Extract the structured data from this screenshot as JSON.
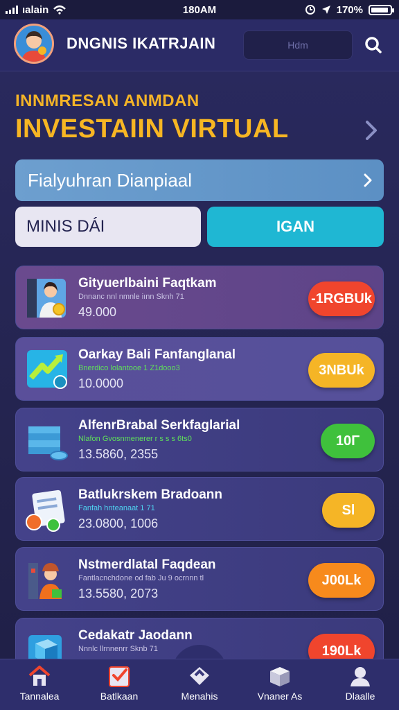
{
  "status_bar": {
    "carrier": "ıalain",
    "time": "180AM",
    "battery_text": "170%",
    "battery_level": 0.8
  },
  "header": {
    "title": "DNGNIS IKATRJAIN",
    "search_placeholder": "Hdm"
  },
  "hero": {
    "subtitle": "INNMRESAN ANMDAN",
    "title": "INVESTAIIN VIRTUAL"
  },
  "banner": {
    "label": "Fialyuhran Dianpiaal"
  },
  "segments": {
    "left": "MINIS DÁI",
    "right": "IGAN"
  },
  "colors": {
    "accent_gold": "#f7b623",
    "accent_cyan": "#1fb7d3",
    "pill_red": "#f0452d",
    "pill_yellow": "#f5b526",
    "pill_green": "#3fc13c",
    "pill_orange": "#f78a1c"
  },
  "items": [
    {
      "name": "Gityuerlbaini Faqtkam",
      "sub": "Dnnanc nnl nmnle iınn Sknh 71",
      "sub_color": "#c9c4e4",
      "value": "49.000",
      "badge": "-1RGBUk",
      "badge_color": "#f0452d",
      "icon": "cash-register-person-icon"
    },
    {
      "name": "Oarkay Bali Fanfanglanal",
      "sub": "Bnerdico lolantooe 1 Z1dooo3",
      "sub_color": "#5fe05a",
      "value": "10.0000",
      "badge": "3NBUk",
      "badge_color": "#f5b526",
      "icon": "trend-chart-icon"
    },
    {
      "name": "AlfenrBrabal Serkfaglarial",
      "sub": "Nlafon Gvosnmenerer r s s s 6ts0",
      "sub_color": "#5fe05a",
      "value": "13.5860, 2355",
      "badge": "10Γ",
      "badge_color": "#3fc13c",
      "icon": "stacked-books-icon"
    },
    {
      "name": "Batlukrskem Bradoann",
      "sub": "Fanfah hnteanaat 1 71",
      "sub_color": "#4fd3f0",
      "value": "23.0800, 1006",
      "badge": "Sl",
      "badge_color": "#f5b526",
      "icon": "document-coins-icon"
    },
    {
      "name": "Nstmerdlatal Faqdean",
      "sub": "Fantlacnchdone od fab Ju 9 ocrnnn tl",
      "sub_color": "#c9c4e4",
      "value": "13.5580, 2073",
      "badge": "J00Lk",
      "badge_color": "#f78a1c",
      "icon": "worker-person-icon"
    },
    {
      "name": "Cedakatr Jaodann",
      "sub": "Nnnlc llrnnenrr Sknb 71",
      "sub_color": "#c9c4e4",
      "value": "",
      "badge": "190Lk",
      "badge_color": "#f0452d",
      "icon": "cube-box-icon"
    }
  ],
  "nav": [
    {
      "label": "Tannalea",
      "icon": "home-icon"
    },
    {
      "label": "Batlkaan",
      "icon": "checklist-icon"
    },
    {
      "label": "Menahis",
      "icon": "tag-icon"
    },
    {
      "label": "Vnaner As",
      "icon": "box-icon"
    },
    {
      "label": "Dlaalle",
      "icon": "profile-icon"
    }
  ]
}
